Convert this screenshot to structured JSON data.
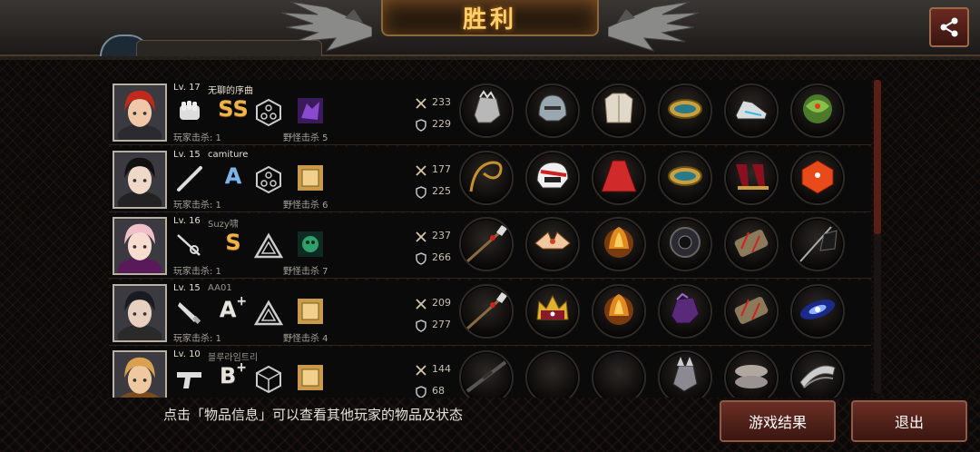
{
  "header": {
    "title": "胜利",
    "share_icon": "share-icon"
  },
  "players": [
    {
      "level": "Lv. 17",
      "name": "无聊的序曲",
      "name_dim": false,
      "weapon_icon": "fist-icon",
      "rank": "SS",
      "rank_color": "gold",
      "skill_icon": "hexagon-skill-icon",
      "pet_icon": "purple-beast-icon",
      "player_kills": "玩家击杀: 1",
      "monster_kills": "野怪击杀 5",
      "attack": "233",
      "defense": "229",
      "items": [
        "gauntlet-icon",
        "helmet-icon",
        "armor-icon",
        "bracelet-icon",
        "boots-icon",
        "dragon-orb-icon"
      ]
    },
    {
      "level": "Lv. 15",
      "name": "camiture",
      "name_dim": false,
      "weapon_icon": "bat-icon",
      "rank": "A",
      "rank_color": "blue",
      "skill_icon": "hexagon-skill-icon",
      "pet_icon": "gold-box-icon",
      "player_kills": "玩家击杀: 1",
      "monster_kills": "野怪击杀 6",
      "attack": "177",
      "defense": "225",
      "items": [
        "whip-icon",
        "race-helmet-icon",
        "red-dress-icon",
        "bracelet-icon",
        "heels-icon",
        "dice-icon"
      ]
    },
    {
      "level": "Lv. 16",
      "name": "Suzy啸",
      "name_dim": true,
      "weapon_icon": "rapier-icon",
      "rank": "S",
      "rank_color": "gold",
      "skill_icon": "triangle-skill-icon",
      "pet_icon": "green-monster-icon",
      "player_kills": "玩家击杀: 1",
      "monster_kills": "野怪击杀 7",
      "attack": "237",
      "defense": "266",
      "items": [
        "spear-icon",
        "winged-crown-icon",
        "flame-armor-icon",
        "dark-ring-icon",
        "wrap-icon",
        "black-flag-icon"
      ]
    },
    {
      "level": "Lv. 15",
      "name": "AA01",
      "name_dim": true,
      "weapon_icon": "knife-icon",
      "rank": "A",
      "rank_plus": "+",
      "rank_color": "silver",
      "skill_icon": "triangle-skill-icon",
      "pet_icon": "gold-box-icon",
      "player_kills": "玩家击杀: 1",
      "monster_kills": "野怪击杀 4",
      "attack": "209",
      "defense": "277",
      "items": [
        "spear-icon",
        "crown-icon",
        "flame-armor-icon",
        "purple-gauntlet-icon",
        "wrap-icon",
        "galaxy-icon"
      ]
    },
    {
      "level": "Lv. 10",
      "name": "블루라임트리",
      "name_dim": true,
      "weapon_icon": "pistol-icon",
      "rank": "B",
      "rank_plus": "+",
      "rank_color": "silver",
      "skill_icon": "cube-skill-icon",
      "pet_icon": "gold-box-icon",
      "player_kills": "",
      "monster_kills": "",
      "attack": "144",
      "defense": "68",
      "items": [
        "rifle-icon",
        "empty-slot",
        "empty-slot",
        "spiked-gauntlet-icon",
        "shoes-icon",
        "blade-icon"
      ]
    }
  ],
  "footer": {
    "hint": "点击「物品信息」可以查看其他玩家的物品及状态",
    "results_label": "游戏结果",
    "exit_label": "退出"
  },
  "colors": {
    "accent_gold": "#ffcf6a",
    "button_red": "#6a2e24"
  }
}
